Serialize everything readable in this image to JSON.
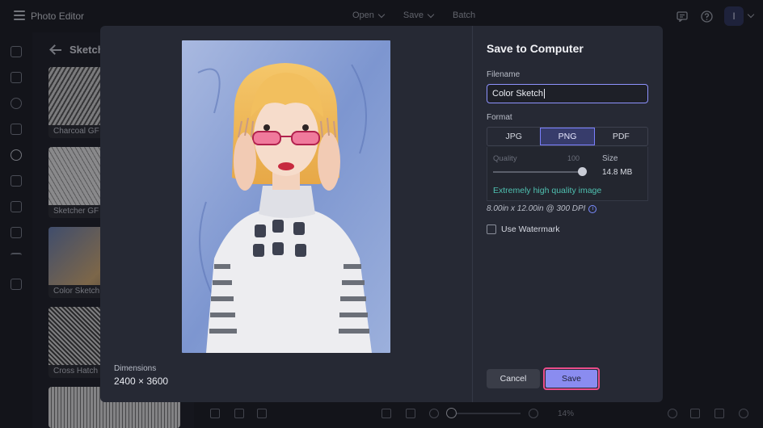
{
  "topbar": {
    "app_title": "Photo Editor",
    "menu": [
      "Open",
      "Save",
      "Batch"
    ],
    "user_initial": "I"
  },
  "side_panel": {
    "title": "Sketch",
    "items": [
      "Charcoal GF",
      "Sketcher GF",
      "Color Sketch",
      "Cross Hatch"
    ]
  },
  "bottombar": {
    "zoom": "14%"
  },
  "modal": {
    "dimensions_label": "Dimensions",
    "dimensions_value": "2400 × 3600",
    "title": "Save to Computer",
    "filename_label": "Filename",
    "filename_value": "Color Sketch",
    "format_label": "Format",
    "formats": [
      "JPG",
      "PNG",
      "PDF"
    ],
    "selected_format": "PNG",
    "quality_label": "Quality",
    "quality_value": "100",
    "size_label": "Size",
    "size_value": "14.8 MB",
    "quality_note": "Extremely high quality image",
    "print_size": "8.00in x 12.00in @ 300 DPI",
    "watermark_label": "Use Watermark",
    "cancel_label": "Cancel",
    "save_label": "Save"
  },
  "colors": {
    "accent": "#8a8cf0",
    "highlight": "#e94d8a",
    "note": "#4fc0b0"
  }
}
